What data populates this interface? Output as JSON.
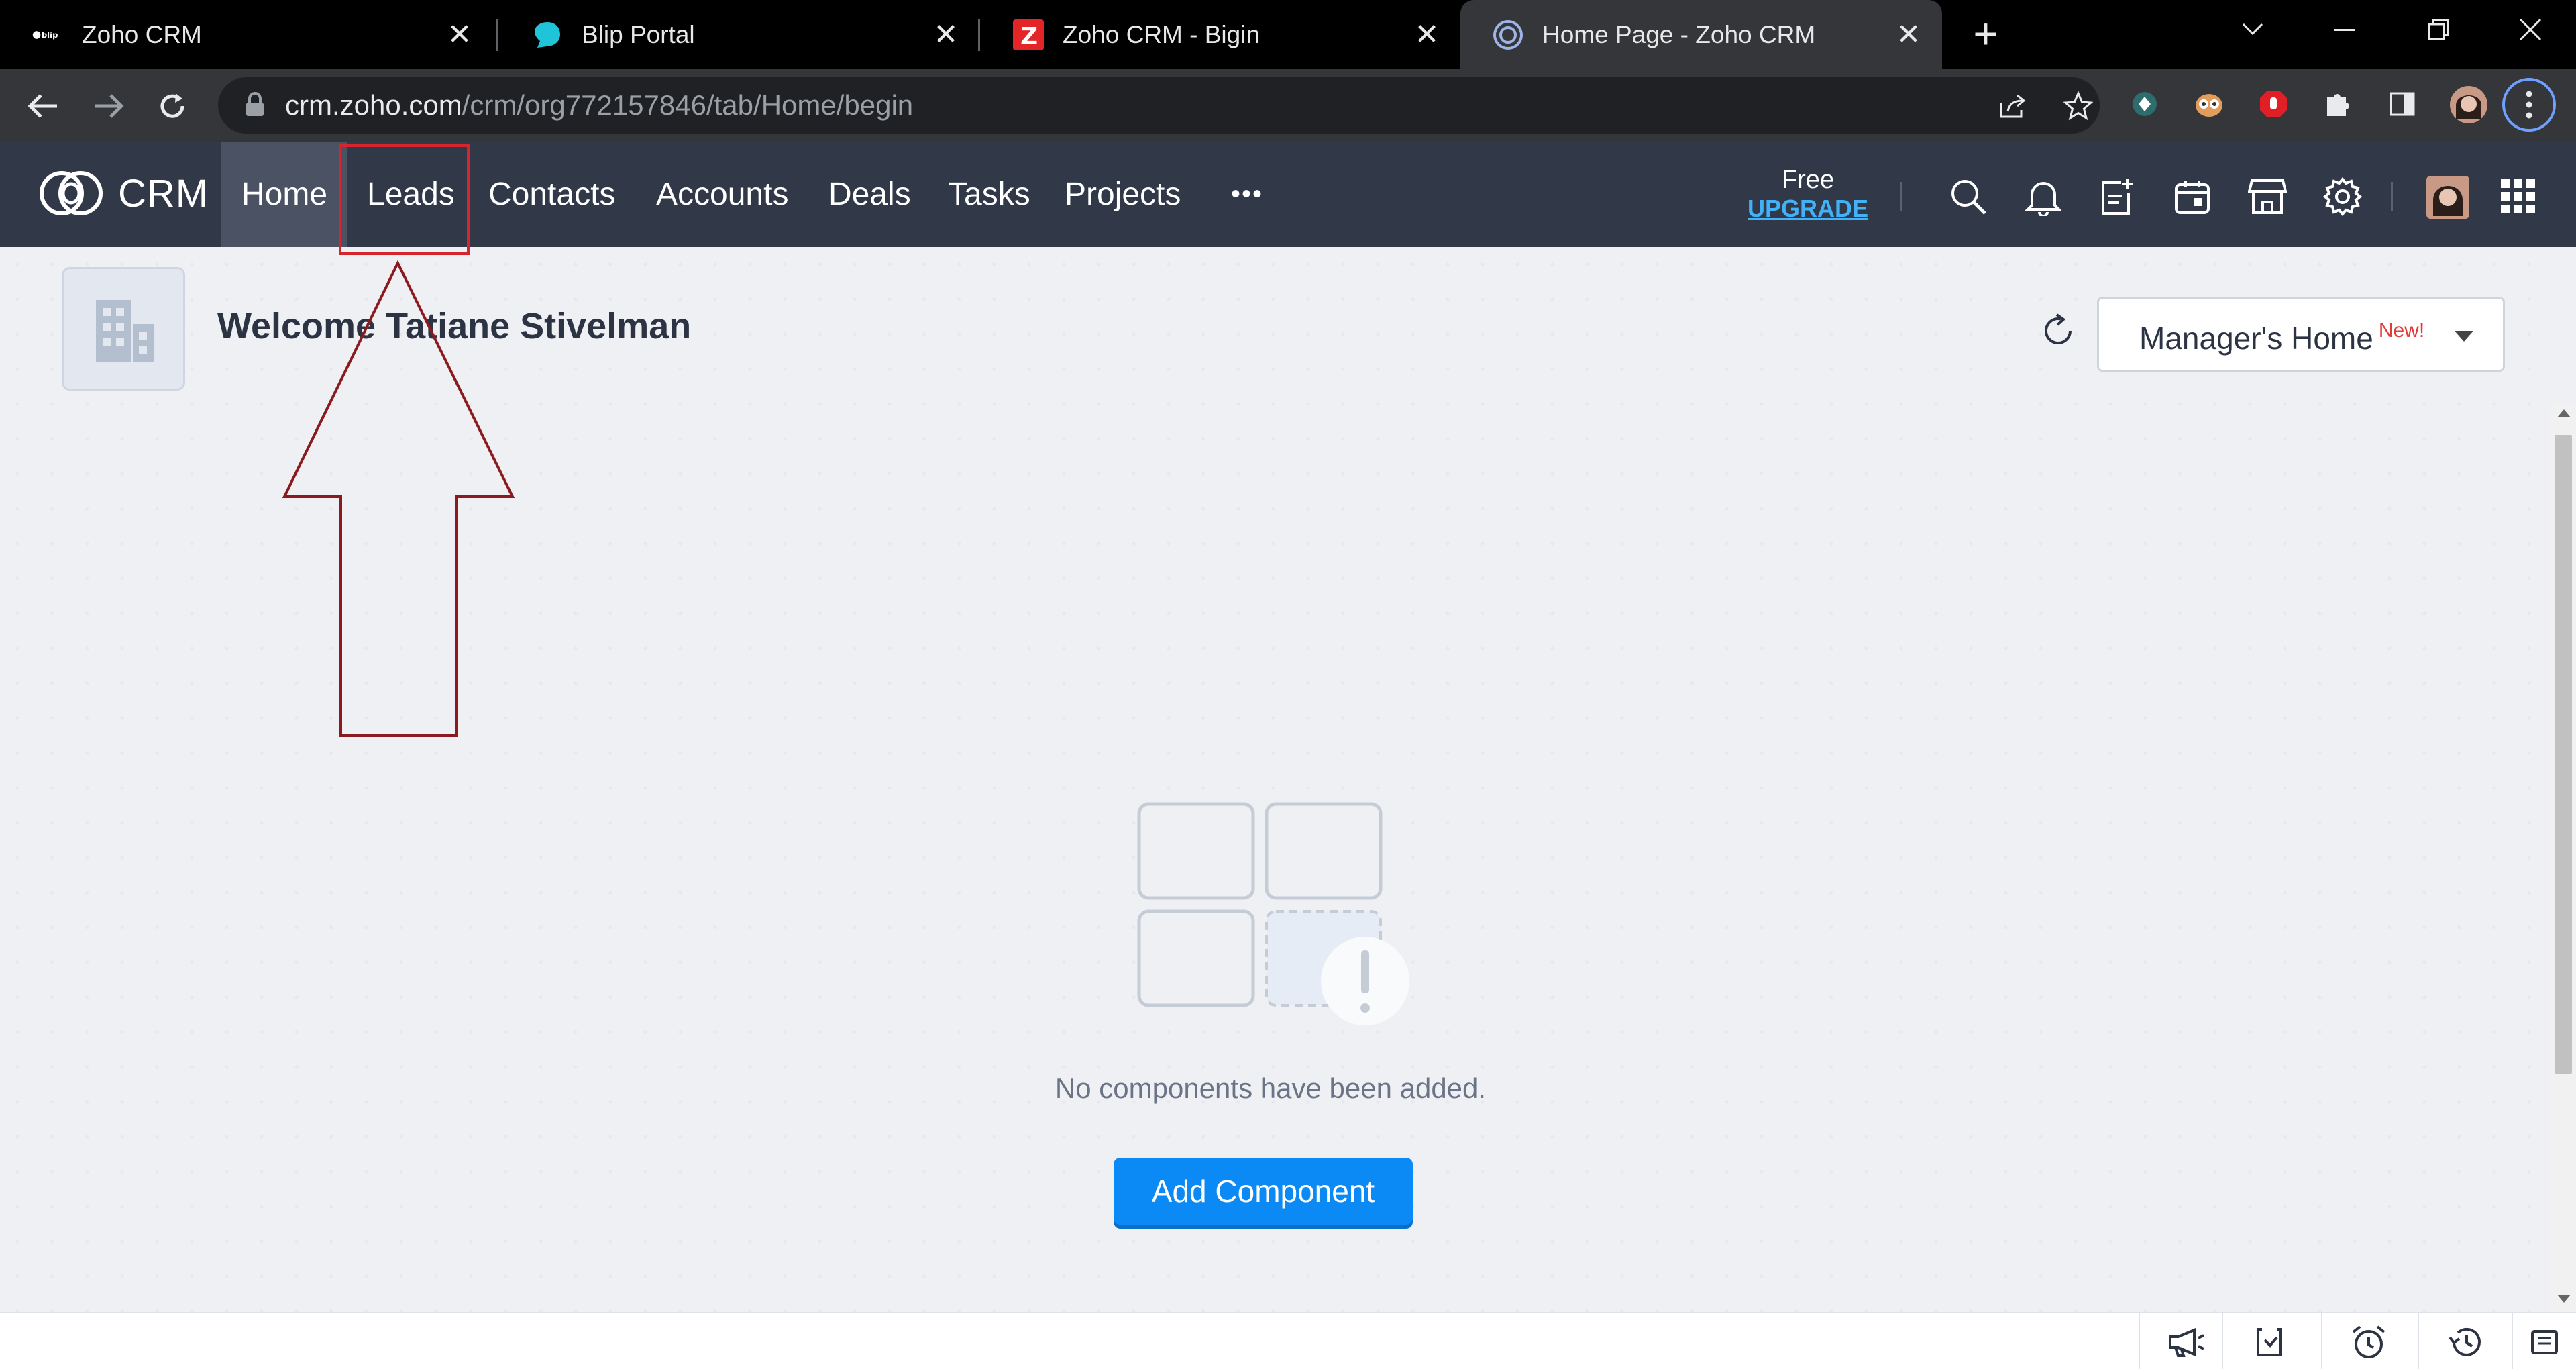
{
  "browser": {
    "tabs": [
      {
        "title": "Zoho CRM",
        "favicon": "blip-icon"
      },
      {
        "title": "Blip Portal",
        "favicon": "blip-portal-icon"
      },
      {
        "title": "Zoho CRM - Bigin",
        "favicon": "zoho-z-icon"
      },
      {
        "title": "Home Page - Zoho CRM",
        "favicon": "zoho-crm-icon",
        "active": true
      }
    ],
    "new_tab": "+",
    "close_glyph": "✕",
    "url_host": "crm.zoho.com",
    "url_path": "/crm/org772157846/tab/Home/begin"
  },
  "crm": {
    "logo_text": "CRM",
    "nav": [
      "Home",
      "Leads",
      "Contacts",
      "Accounts",
      "Deals",
      "Tasks",
      "Projects"
    ],
    "more": "•••",
    "plan": "Free",
    "upgrade": "UPGRADE"
  },
  "page": {
    "welcome": "Welcome Tatiane Stivelman",
    "home_selector": "Manager's Home",
    "home_selector_badge": "New!",
    "empty_message": "No components have been added.",
    "add_button": "Add Component"
  },
  "colors": {
    "header_bg": "#313949",
    "accent": "#0b89f5",
    "upgrade_link": "#43b1f7",
    "annotation": "#8b1a1f"
  }
}
